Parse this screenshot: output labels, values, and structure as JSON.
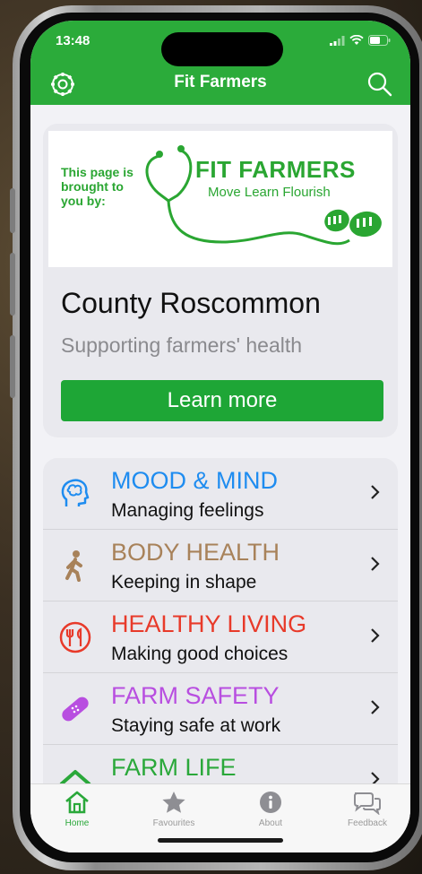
{
  "status_bar": {
    "time": "13:48"
  },
  "header": {
    "title": "Fit Farmers",
    "settings_icon": "settings-icon",
    "search_icon": "search-icon",
    "bg_color": "#2bab3a"
  },
  "sponsor": {
    "banner": {
      "lead": "This page is brought to you by:",
      "title": "FIT FARMERS",
      "subtitle": "Move Learn Flourish"
    },
    "name": "County Roscommon",
    "subtitle": "Supporting farmers' health",
    "button_label": "Learn more"
  },
  "menu": {
    "items": [
      {
        "title": "MOOD & MIND",
        "subtitle": "Managing feelings",
        "color": "#1e8cf0",
        "icon": "head-brain-icon"
      },
      {
        "title": "BODY HEALTH",
        "subtitle": "Keeping in shape",
        "color": "#a8825a",
        "icon": "walking-person-icon"
      },
      {
        "title": "HEALTHY LIVING",
        "subtitle": "Making good choices",
        "color": "#e83a2a",
        "icon": "fork-knife-icon"
      },
      {
        "title": "FARM SAFETY",
        "subtitle": "Staying safe at work",
        "color": "#b84ee0",
        "icon": "bandage-icon"
      },
      {
        "title": "FARM LIFE",
        "subtitle": "",
        "color": "#2aa83a",
        "icon": "farm-house-icon"
      }
    ]
  },
  "tabs": [
    {
      "label": "Home",
      "icon": "home-icon",
      "active": true,
      "color": "#2aa83a"
    },
    {
      "label": "Favourites",
      "icon": "star-icon",
      "active": false
    },
    {
      "label": "About",
      "icon": "info-icon",
      "active": false
    },
    {
      "label": "Feedback",
      "icon": "chat-bubbles-icon",
      "active": false
    }
  ]
}
